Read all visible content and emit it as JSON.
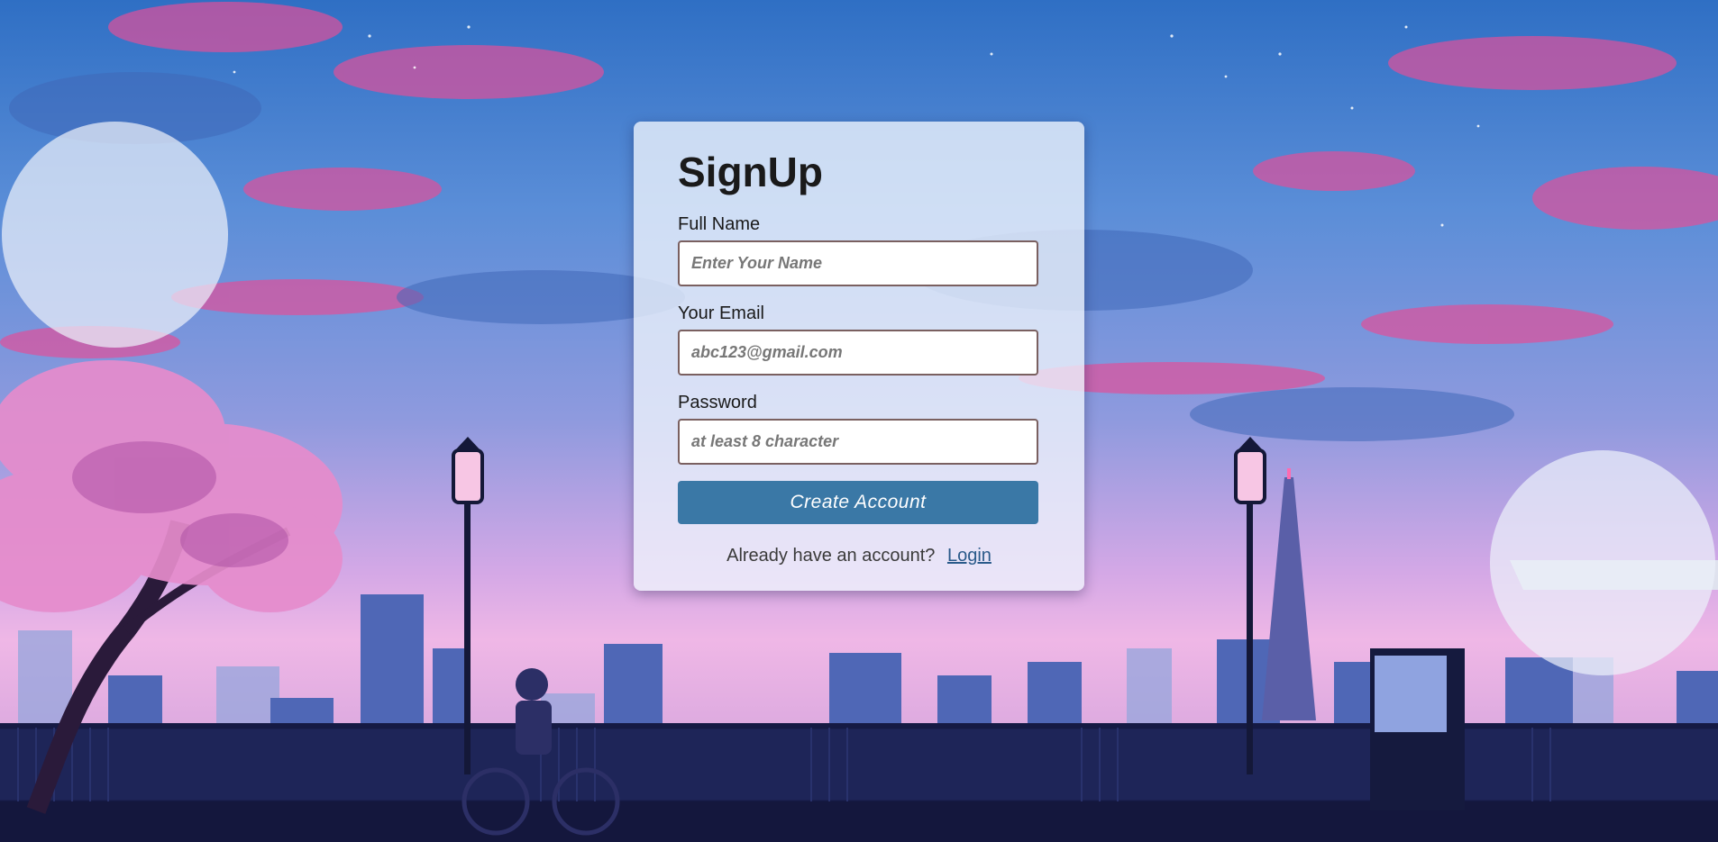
{
  "form": {
    "title": "SignUp",
    "fields": [
      {
        "label": "Full Name",
        "placeholder": "Enter Your Name",
        "type": "text"
      },
      {
        "label": "Your Email",
        "placeholder": "abc123@gmail.com",
        "type": "email"
      },
      {
        "label": "Password",
        "placeholder": "at least 8 character",
        "type": "password"
      }
    ],
    "submit_label": "Create Account",
    "login_prompt": "Already have an account?",
    "login_link": "Login"
  },
  "colors": {
    "button": "#3a78a6",
    "link": "#2a5a8a",
    "input_border": "#7a6060"
  }
}
